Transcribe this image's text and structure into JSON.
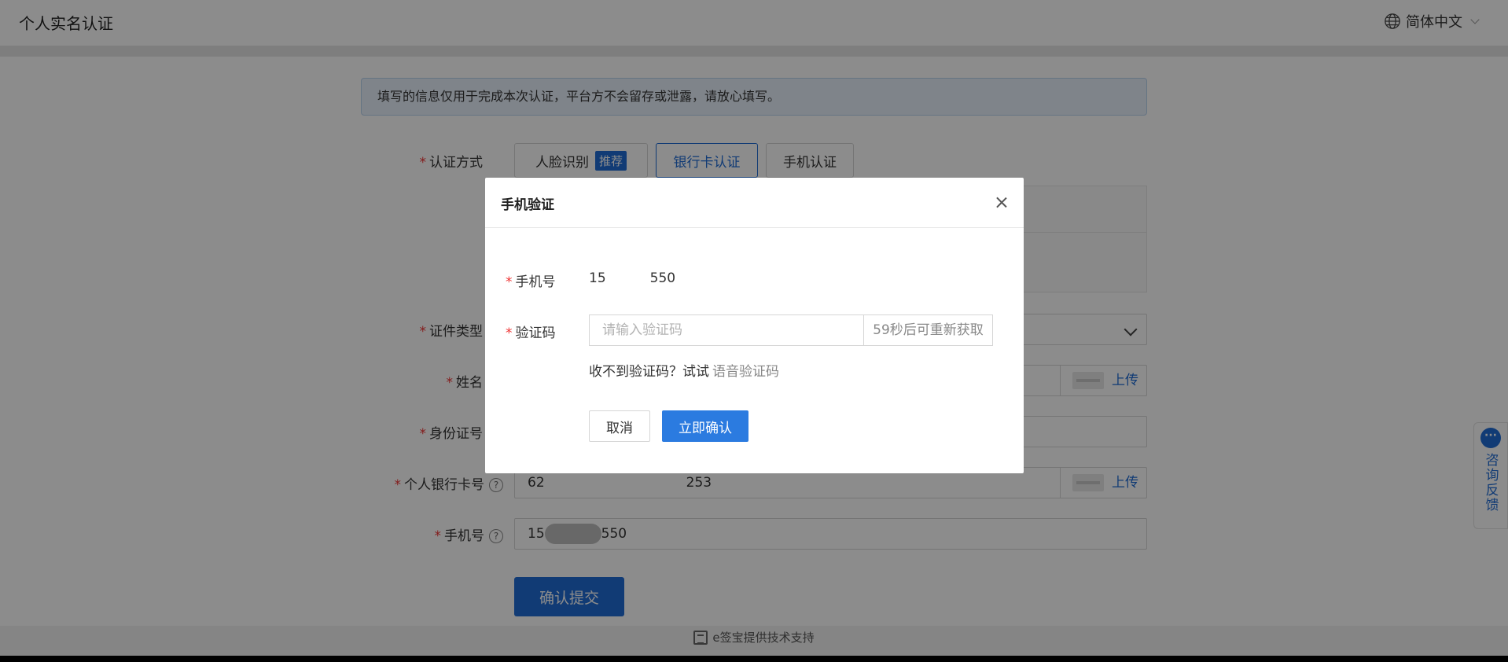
{
  "header": {
    "title": "个人实名认证",
    "language": "简体中文"
  },
  "notice": "填写的信息仅用于完成本次认证，平台方不会留存或泄露，请放心填写。",
  "form": {
    "method_label": "认证方式",
    "methods": [
      {
        "label": "人脸识别",
        "tag": "推荐",
        "active": false
      },
      {
        "label": "银行卡认证",
        "active": true
      },
      {
        "label": "手机认证",
        "active": false
      }
    ],
    "id_type_label": "证件类型",
    "name_label": "姓名",
    "id_number_label": "身份证号",
    "bank_card_label": "个人银行卡号",
    "bank_card_value_start": "62",
    "bank_card_value_end": "253",
    "phone_label": "手机号",
    "phone_value_start": "15",
    "phone_value_end": "550",
    "upload_label": "上传",
    "submit_label": "确认提交"
  },
  "footer": {
    "text": "e签宝提供技术支持"
  },
  "side_float": {
    "label": "咨询反馈"
  },
  "modal": {
    "title": "手机验证",
    "phone_label": "手机号",
    "phone_start": "15",
    "phone_end": "550",
    "code_label": "验证码",
    "code_placeholder": "请输入验证码",
    "countdown": "59秒后可重新获取",
    "hint_text": "收不到验证码？试试",
    "voice_link": "语音验证码",
    "cancel_label": "取消",
    "confirm_label": "立即确认"
  },
  "colors": {
    "primary": "#1f6cd6",
    "required": "#e33333",
    "overlay": "rgba(0,0,0,0.45)"
  }
}
